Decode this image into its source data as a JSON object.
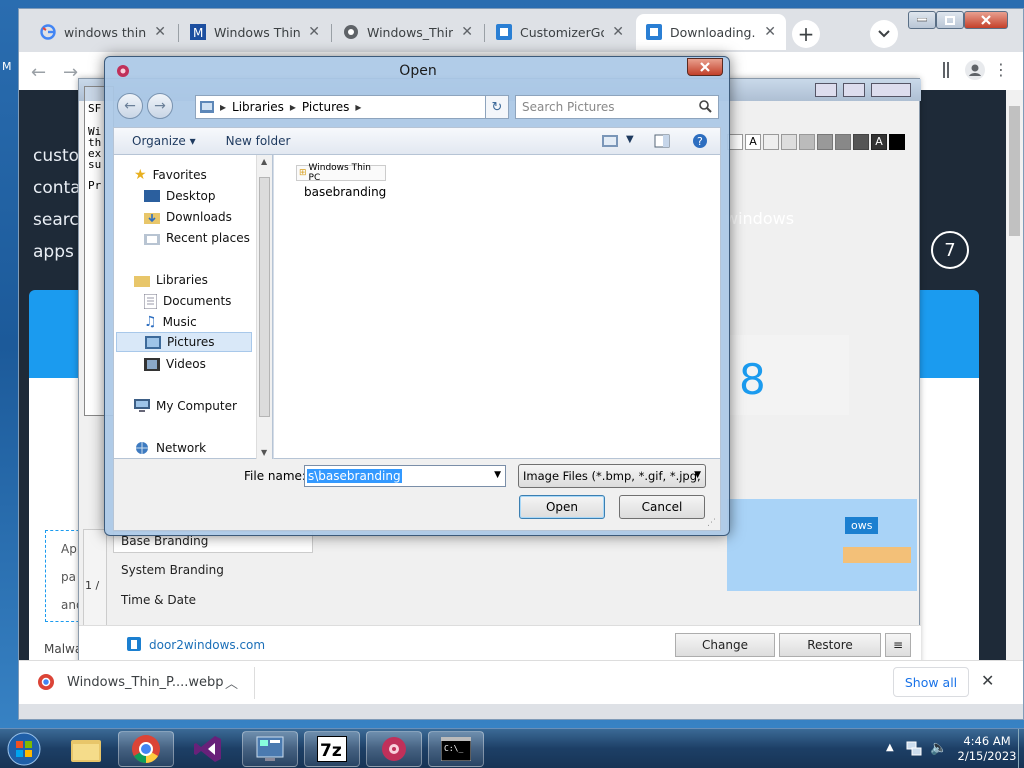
{
  "browser": {
    "tabs": [
      {
        "label": "windows thin pc",
        "icon": "google-icon"
      },
      {
        "label": "Windows Thin PC",
        "icon": "m-site-icon"
      },
      {
        "label": "Windows_Thin_P",
        "icon": "globe-icon"
      },
      {
        "label": "CustomizerGod",
        "icon": "site-icon"
      },
      {
        "label": "Downloading...",
        "icon": "site-icon"
      }
    ],
    "new_tab": "+",
    "download_file": "Windows_Thin_P....webp",
    "show_all": "Show all"
  },
  "page": {
    "nav": [
      "custo",
      "conta",
      "searc",
      "apps"
    ],
    "right_text": "windows",
    "circle_number": "7",
    "big_number": "8",
    "card_lines": [
      "App",
      "pa",
      "and do"
    ],
    "malware": "Malware/"
  },
  "cmd": {
    "lines": [
      "SF",
      "Wi",
      "th",
      "ex",
      "su",
      "Pr"
    ],
    "page_indicator": "1 /"
  },
  "app": {
    "list": [
      "Base Branding",
      "System Branding",
      "Time & Date"
    ],
    "footer_link": "door2windows.com",
    "change": "Change",
    "restore": "Restore",
    "menu": "≡",
    "badge": "ows"
  },
  "dialog": {
    "title": "Open",
    "breadcrumb": [
      "Libraries",
      "Pictures"
    ],
    "search_placeholder": "Search Pictures",
    "organize": "Organize",
    "new_folder": "New folder",
    "nav": {
      "favorites": "Favorites",
      "fav_items": [
        "Desktop",
        "Downloads",
        "Recent places"
      ],
      "libraries": "Libraries",
      "lib_items": [
        "Documents",
        "Music",
        "Pictures",
        "Videos"
      ],
      "computer": "My Computer",
      "network": "Network"
    },
    "file": {
      "thumb_label": "Windows Thin PC",
      "name": "basebranding"
    },
    "filename_label": "File name:",
    "filename_value": "s\\basebranding",
    "filetype": "Image Files (*.bmp, *.gif, *.jpg,",
    "open": "Open",
    "cancel": "Cancel"
  },
  "taskbar": {
    "time": "4:46 AM",
    "date": "2/15/2023",
    "apps": [
      "explorer",
      "chrome",
      "visual-studio",
      "control-panel",
      "7zip",
      "customizer-god",
      "cmd"
    ]
  },
  "colors": {
    "accent": "#1b9bef",
    "dialog_glass": "#aac8e6"
  }
}
